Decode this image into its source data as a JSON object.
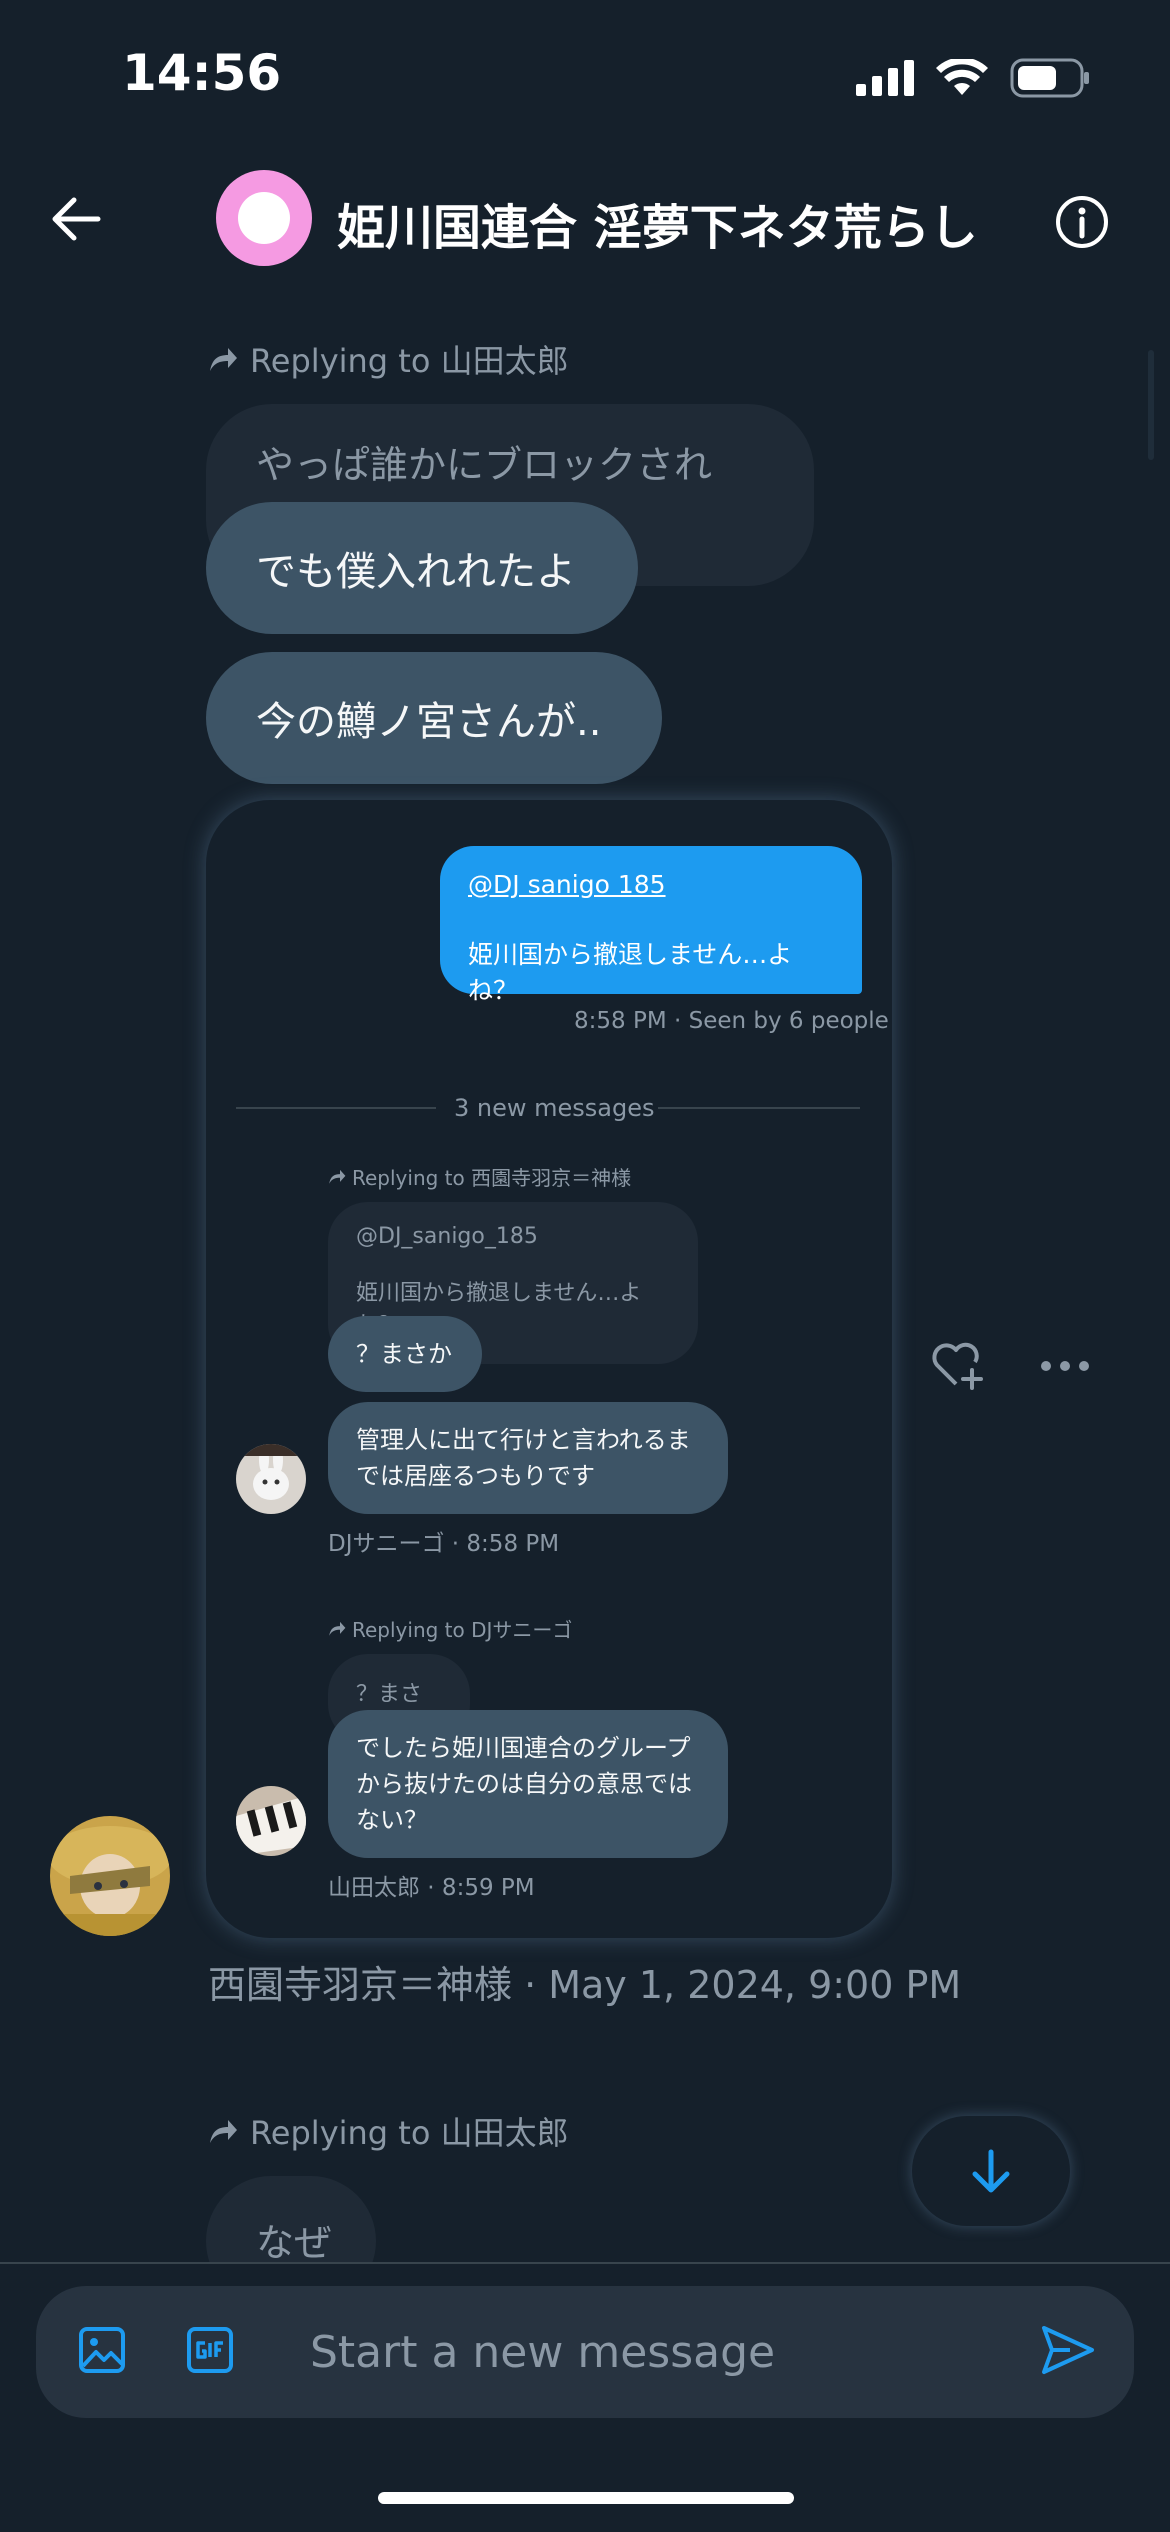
{
  "status_bar": {
    "time": "14:56"
  },
  "header": {
    "title": "姫川国連合 淫夢下ネタ荒らし"
  },
  "thread": {
    "reply_to_1": "Replying to 山田太郎",
    "quoted_1": "やっぱ誰かにブロックされた？",
    "msg_1": "でも僕入れれたよ",
    "msg_2": "今の鱒ノ宮さんが..",
    "shared": {
      "own_mention": "@DJ sanigo 185",
      "own_text": "姫川国から撤退しません…よね？",
      "own_meta": "8:58 PM · Seen by 6 people",
      "new_messages": "3 new messages",
      "reply_a": "Replying to 西園寺羽京＝神様",
      "quote_a_mention": "@DJ_sanigo_185",
      "quote_a_text": "姫川国から撤退しません…よね？",
      "bubble_a1": "？まさか",
      "bubble_a2": "管理人に出て行けと言われるまでは居座るつもりです",
      "meta_a": "DJサニーゴ · 8:58 PM",
      "reply_b": "Replying to DJサニーゴ",
      "quote_b": "？まさか",
      "bubble_b": "でしたら姫川国連合のグループから抜けたのは自分の意思ではない？",
      "meta_b": "山田太郎 · 8:59 PM"
    },
    "sender_meta": "西園寺羽京＝神様 · May 1, 2024, 9:00 PM",
    "reply_to_2": "Replying to 山田太郎",
    "msg_3": "なぜ"
  },
  "composer": {
    "placeholder": "Start a new message"
  },
  "icons": {
    "accent": "#1d9bf0",
    "back": "arrow-left-icon",
    "info": "info-icon",
    "like": "heart-plus-icon",
    "more": "more-icon",
    "media": "image-icon",
    "gif": "gif-icon",
    "send": "send-icon",
    "scroll": "arrow-down-icon"
  }
}
